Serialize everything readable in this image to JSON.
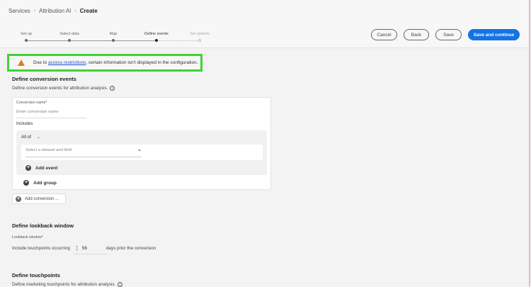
{
  "breadcrumb": [
    "Services",
    "Attribution AI",
    "Create"
  ],
  "steps": [
    {
      "label": "Set up"
    },
    {
      "label": "Select data"
    },
    {
      "label": "Map"
    },
    {
      "label": "Define events"
    },
    {
      "label": "Set options"
    }
  ],
  "buttons": {
    "cancel": "Cancel",
    "back": "Back",
    "save": "Save",
    "save_continue": "Save and continue"
  },
  "alert": {
    "prefix": "Due to ",
    "link": "access restrictions",
    "suffix": ", certain information isn't displayed in the configuration."
  },
  "conversion": {
    "title": "Define conversion events",
    "subtitle": "Define conversion events for attribution analysis.",
    "name_label": "Conversion name*",
    "name_placeholder": "Enter conversion name",
    "includes": "Includes",
    "all_of": "All of",
    "select_placeholder": "Select a dataset and field",
    "add_event": "Add event",
    "add_group": "Add group",
    "add_conversion": "Add conversion ..."
  },
  "lookback": {
    "title": "Define lookback window",
    "label": "Lookback window*",
    "prefix": "Include touchpoints occurring",
    "value": "56",
    "suffix": "days prior the conversion"
  },
  "touchpoints": {
    "title": "Define touchpoints",
    "subtitle": "Define marketing touchpoints for attribution analysis."
  },
  "colors": {
    "primary": "#1473e6",
    "warning": "#e07b18",
    "highlight": "#3fd332"
  }
}
